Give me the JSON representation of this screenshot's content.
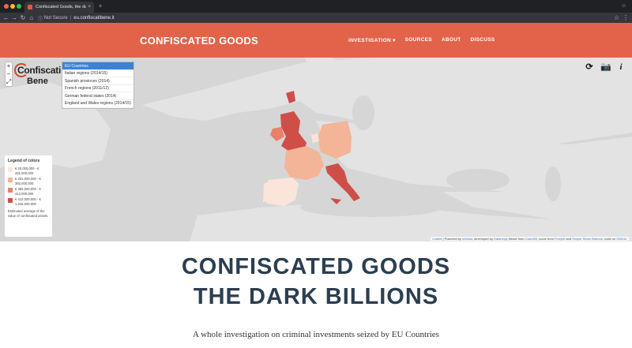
{
  "browser": {
    "tab_title": "Confiscated Goods, the dark b...",
    "tab_close": "×",
    "security": "Not Secure",
    "url": "eu.confiscatibene.it"
  },
  "header": {
    "brand": "CONFISCATED GOODS",
    "nav": [
      "INVESTIGATION ▾",
      "SOURCES",
      "ABOUT",
      "DISCUSS"
    ]
  },
  "map": {
    "zoom_in": "+",
    "zoom_out": "−",
    "fullscreen": "⤢",
    "logo_line1": "Confiscati",
    "logo_line2": "Bene",
    "layers": [
      "EU Countries",
      "Italian regions (2014/15)",
      "Spanish provinces (2014)",
      "French regions (2011/12)",
      "German federal states (2014)",
      "England and Wales regions (2014/15)"
    ],
    "active_layer": 0,
    "tools": [
      "⟳",
      "📷",
      "i"
    ],
    "legend": {
      "title": "Legend of colors",
      "rows": [
        {
          "color": "#fbe5da",
          "text": "€ 20,000,000 - € 251,000,000"
        },
        {
          "color": "#f4b498",
          "text": "€ 251,000,000 - € 382,000,000"
        },
        {
          "color": "#e8806a",
          "text": "€ 382,000,000 - € 412,000,000"
        },
        {
          "color": "#cd4f48",
          "text": "€ 412,000,000 - € 1,816,000,000"
        }
      ],
      "note": "Estimated average of the value of confiscated assets."
    },
    "attribution": {
      "leaflet": "Leaflet",
      "part1": " | Powered by ",
      "ondata": "onData",
      "part2": ", developed by ",
      "dataninja": "Dataninja",
      "part3": ", tileset from ",
      "cartodb": "CartoDB",
      "part4": ", icons from ",
      "freepik": "Freepik",
      "part5": " and ",
      "simple": "Simple Share Buttons",
      "part6": ", code on ",
      "github": "GitHub",
      "part7": "."
    },
    "colors": {
      "ocean": "#d4d4d4",
      "land": "#e4e4e4",
      "very_low": "#fbe5da",
      "low": "#f4b498",
      "mid": "#e8806a",
      "high": "#cd4f48"
    }
  },
  "hero": {
    "title_line1": "CONFISCATED GOODS",
    "title_line2": "THE DARK BILLIONS",
    "subtitle": "A whole investigation on criminal investments seized by EU Countries"
  }
}
